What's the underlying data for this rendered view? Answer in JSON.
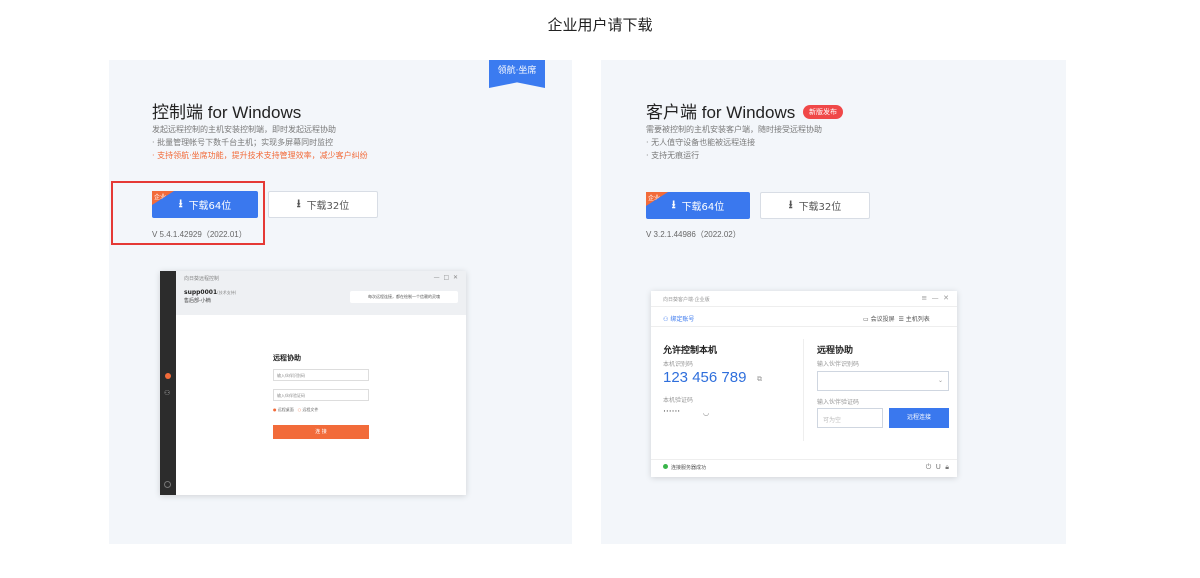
{
  "page": {
    "title": "企业用户请下载"
  },
  "control": {
    "ribbon": "领航·坐席",
    "title_zh": "控制端",
    "title_en": " for Windows",
    "desc": [
      "发起远程控制的主机安装控制端，即时发起远程协助",
      "· 批量管理帐号下数千台主机；实现多屏幕同时监控"
    ],
    "desc_highlight": "· 支持领航·坐席功能，提升技术支持管理效率，减少客户纠纷",
    "corner_tag": "企业",
    "btn64": "下载64位",
    "btn32": "下载32位",
    "version": "V 5.4.1.42929（2022.01）",
    "mock": {
      "window_title": "向日葵远程控制",
      "user": "supp0001",
      "user_tag": "(技术支持)",
      "user_sub": "售后部-小楠",
      "tip": "每次远程连接，都在绘制一个信赖的灵魂",
      "section": "远程协助",
      "placeholder_id": "输入伙伴识别码",
      "placeholder_code": "输入伙伴验证码",
      "opt1": "远程桌面",
      "opt2": "远程文件",
      "go": "连 接"
    }
  },
  "client": {
    "title_zh": "客户端",
    "title_en": " for Windows",
    "badge": "新版发布",
    "desc": [
      "需要被控制的主机安装客户端，随时接受远程协助",
      "· 无人值守设备也能被远程连接",
      "· 支持无痕运行"
    ],
    "corner_tag": "企业",
    "btn64": "下载64位",
    "btn32": "下载32位",
    "version": "V 3.2.1.44986（2022.02）",
    "mock": {
      "window_title": "向日葵客户端·企业版",
      "bind": "绑定账号",
      "screen": "会议投屏",
      "host_list": "主机列表",
      "allow": "允许控制本机",
      "local_id_label": "本机识别码",
      "local_id": "123 456 789",
      "local_code_label": "本机验证码",
      "local_code": "······",
      "remote": "远程协助",
      "partner_id_label": "输入伙伴识别码",
      "partner_code_label": "输入伙伴验证码",
      "partner_code_ph": "可为空",
      "connect": "远程连接",
      "status": "连接服务器成功"
    }
  }
}
